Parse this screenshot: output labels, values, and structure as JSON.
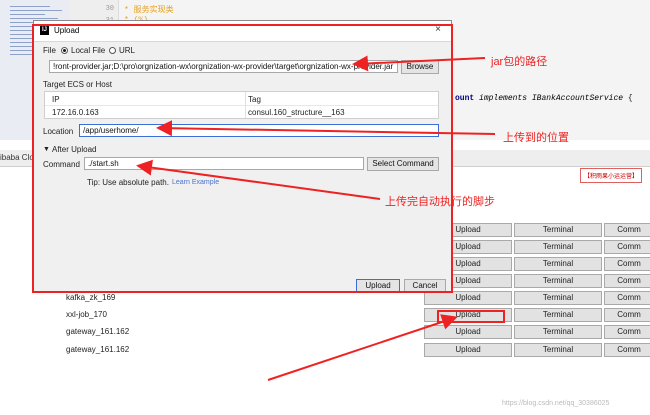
{
  "editor": {
    "line_numbers": [
      "30",
      "31"
    ],
    "comment_line_1": "*  服务实现类",
    "comment_line_2": "*  (%)",
    "code_line": [
      "ount",
      "implements",
      "IBankAccountService",
      "{"
    ],
    "tool_tab": "ibaba Clo"
  },
  "hint_badge": "【积雨果小运运营】",
  "dialog": {
    "title": "Upload",
    "close_symbol": "×",
    "file_label": "File",
    "local_file_option": "Local File",
    "url_option": "URL",
    "file_path_value": "!ront-provider.jar;D:\\pro\\orgnization-wx\\orgnization-wx-provider\\target\\orgnization-wx-provider.jar",
    "browse_label": "Browse",
    "target_label": "Target ECS or Host",
    "table_headers": [
      "IP",
      "Tag"
    ],
    "table_rows": [
      [
        "172.16.0.163",
        "consul.160_structure__163"
      ]
    ],
    "location_label": "Location",
    "location_value": "/app/userhome/",
    "after_upload_label": "After Upload",
    "command_label": "Command",
    "command_value": "./start.sh",
    "select_command_label": "Select Command",
    "tip_text": "Tip: Use absolute path.",
    "learn_link": "Learn Example",
    "upload_button": "Upload",
    "cancel_button": "Cancel"
  },
  "servers": [
    {
      "name": "",
      "upload": "Upload",
      "terminal": "Terminal",
      "more": "Comm"
    },
    {
      "name": "",
      "upload": "Upload",
      "terminal": "Terminal",
      "more": "Comm"
    },
    {
      "name": "",
      "upload": "Upload",
      "terminal": "Terminal",
      "more": "Comm"
    },
    {
      "name": "",
      "upload": "Upload",
      "terminal": "Terminal",
      "more": "Comm"
    },
    {
      "name": "kafka_zk_169",
      "upload": "Upload",
      "terminal": "Terminal",
      "more": "Comm"
    },
    {
      "name": "xxl-job_170",
      "upload": "Upload",
      "terminal": "Terminal",
      "more": "Comm"
    },
    {
      "name": "gateway_161.162",
      "upload": "Upload",
      "terminal": "Terminal",
      "more": "Comm"
    },
    {
      "name": "gateway_161.162",
      "upload": "Upload",
      "terminal": "Terminal",
      "more": "Comm"
    }
  ],
  "annotations": {
    "jar_path": "jar包的路径",
    "upload_location": "上传到的位置",
    "auto_script": "上传完自动执行的脚步"
  },
  "watermark": "https://blog.csdn.net/qq_30386025",
  "colors": {
    "annotation_red": "#ee2222",
    "focus_blue": "#3b6fd6",
    "link_blue": "#4a72c8",
    "comment_orange": "#e8a020"
  }
}
